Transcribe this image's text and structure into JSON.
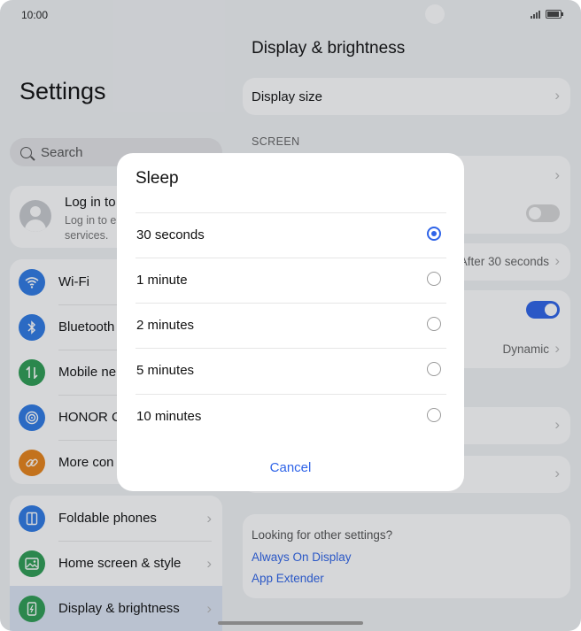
{
  "status": {
    "time": "10:00"
  },
  "left": {
    "title": "Settings",
    "search_placeholder": "Search",
    "login": {
      "title": "Log in to",
      "subtitle": "Log in to e\nservices."
    },
    "menu": [
      {
        "label": "Wi-Fi",
        "icon": "wifi-icon",
        "color": "#2f7be5"
      },
      {
        "label": "Bluetooth",
        "icon": "bluetooth-icon",
        "color": "#2f7be5"
      },
      {
        "label": "Mobile ne",
        "icon": "mobile-network-icon",
        "color": "#2f9e55"
      },
      {
        "label": "HONOR C",
        "icon": "honor-connect-icon",
        "color": "#2f7be5"
      },
      {
        "label": "More con",
        "icon": "link-icon",
        "color": "#e8841a"
      }
    ],
    "menu2": [
      {
        "label": "Foldable phones",
        "icon": "foldable-icon",
        "color": "#2f7be5"
      },
      {
        "label": "Home screen & style",
        "icon": "image-icon",
        "color": "#2f9e55"
      },
      {
        "label": "Display & brightness",
        "icon": "display-icon",
        "color": "#2f9e55"
      }
    ]
  },
  "right": {
    "header": "Display & brightness",
    "display_size": "Display size",
    "section_screen": "SCREEN",
    "sleep_value": "After 30 seconds",
    "dynamic_value": "Dynamic",
    "other": {
      "label": "Looking for other settings?",
      "link1": "Always On Display",
      "link2": "App Extender"
    }
  },
  "dialog": {
    "title": "Sleep",
    "options": [
      "30 seconds",
      "1 minute",
      "2 minutes",
      "5 minutes",
      "10 minutes"
    ],
    "selected": 0,
    "cancel": "Cancel"
  },
  "colors": {
    "accent": "#2f64e8"
  }
}
